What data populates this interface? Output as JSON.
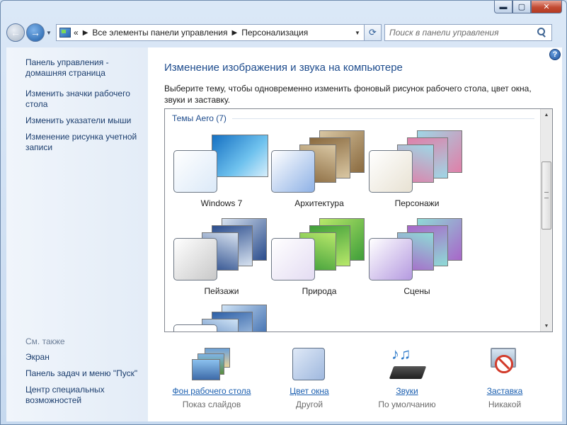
{
  "window": {
    "controls": {
      "minimize": "▬",
      "maximize": "▢",
      "close": "✕"
    }
  },
  "nav": {
    "breadcrumb_overflow": "«",
    "breadcrumbs": [
      "Все элементы панели управления",
      "Персонализация"
    ],
    "search_placeholder": "Поиск в панели управления"
  },
  "sidebar": {
    "links": [
      "Панель управления - домашняя страница",
      "Изменить значки рабочего стола",
      "Изменить указатели мыши",
      "Изменение рисунка учетной записи"
    ],
    "see_also_title": "См. также",
    "see_also": [
      "Экран",
      "Панель задач и меню \"Пуск\"",
      "Центр специальных возможностей"
    ]
  },
  "main": {
    "help": "?",
    "title": "Изменение изображения и звука на компьютере",
    "description": "Выберите тему, чтобы одновременно изменить фоновый рисунок рабочего стола, цвет окна, звуки и заставку.",
    "group_title": "Темы Aero (7)",
    "themes": [
      {
        "name": "Windows 7",
        "colors": [
          "#1a6fc2",
          "#9fd6f5"
        ],
        "glass": "#dbe9f8"
      },
      {
        "name": "Архитектура",
        "colors": [
          "#8a6a3f",
          "#d9c7a3"
        ],
        "glass": "#8fb2e6"
      },
      {
        "name": "Персонажи",
        "colors": [
          "#e07fa8",
          "#9ed7e6"
        ],
        "glass": "#e8e2d3"
      },
      {
        "name": "Пейзажи",
        "colors": [
          "#2a4c8c",
          "#d7e2f0"
        ],
        "glass": "#c8c8c8"
      },
      {
        "name": "Природа",
        "colors": [
          "#3f9e3a",
          "#b8e86a"
        ],
        "glass": "#e4dcf2"
      },
      {
        "name": "Сцены",
        "colors": [
          "#a866c9",
          "#8edbd6"
        ],
        "glass": "#b59ae0"
      },
      {
        "name": "",
        "colors": [
          "#2d5fa6",
          "#cfe3f6"
        ],
        "glass": "#ffffff"
      }
    ]
  },
  "bottom": [
    {
      "link": "Фон рабочего стола",
      "sub": "Показ слайдов"
    },
    {
      "link": "Цвет окна",
      "sub": "Другой"
    },
    {
      "link": "Звуки",
      "sub": "По умолчанию"
    },
    {
      "link": "Заставка",
      "sub": "Никакой"
    }
  ]
}
